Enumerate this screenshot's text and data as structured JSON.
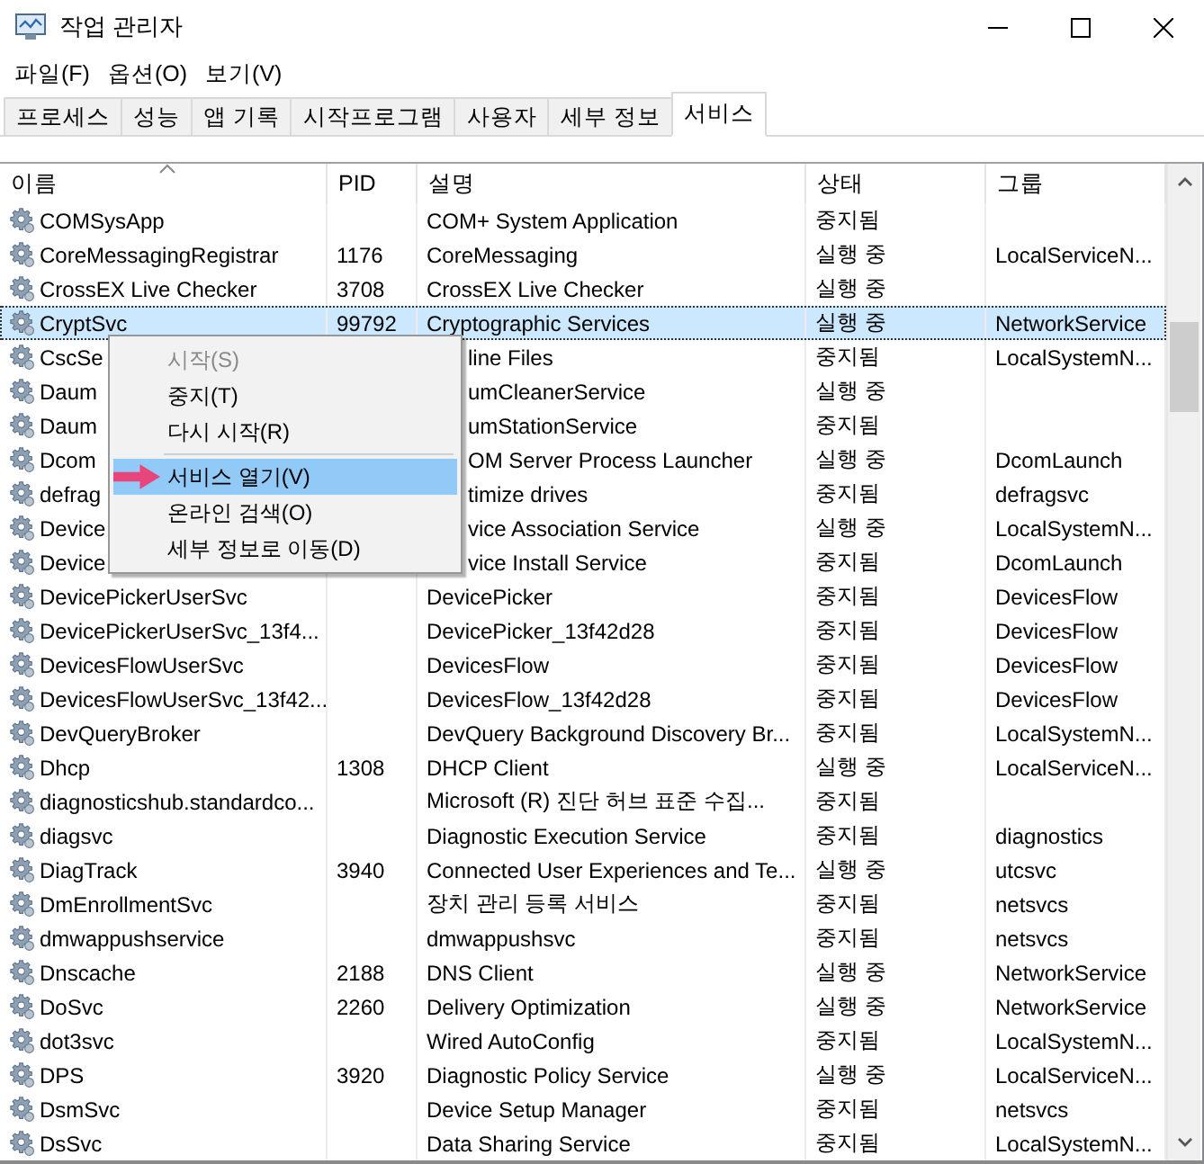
{
  "window": {
    "title": "작업 관리자"
  },
  "menu_bar": [
    "파일(F)",
    "옵션(O)",
    "보기(V)"
  ],
  "tabs": [
    {
      "label": "프로세스",
      "selected": false
    },
    {
      "label": "성능",
      "selected": false
    },
    {
      "label": "앱 기록",
      "selected": false
    },
    {
      "label": "시작프로그램",
      "selected": false
    },
    {
      "label": "사용자",
      "selected": false
    },
    {
      "label": "세부 정보",
      "selected": false
    },
    {
      "label": "서비스",
      "selected": true
    }
  ],
  "table": {
    "columns": [
      "이름",
      "PID",
      "설명",
      "상태",
      "그룹"
    ],
    "rows": [
      {
        "kind": "full",
        "selected": false,
        "name": "COMSysApp",
        "description": "COM+ System Application",
        "status": "중지됨"
      },
      {
        "kind": "full",
        "selected": false,
        "name": "CoreMessagingRegistrar",
        "pid": "1176",
        "description": "CoreMessaging",
        "status": "실행 중",
        "group": "LocalServiceN..."
      },
      {
        "kind": "full",
        "selected": false,
        "name": "CrossEX Live Checker",
        "pid": "3708",
        "description": "CrossEX Live Checker",
        "status": "실행 중"
      },
      {
        "kind": "full",
        "selected": true,
        "name": "CryptSvc",
        "pid": "99792",
        "description": "Cryptographic Services",
        "status": "실행 중",
        "group": "NetworkService"
      },
      {
        "kind": "partly_hidden",
        "selected": false,
        "name": "CscSe",
        "description": "line Files",
        "status": "중지됨",
        "group": "LocalSystemN..."
      },
      {
        "kind": "partly_hidden",
        "selected": false,
        "name": "Daum",
        "description": "umCleanerService",
        "status": "실행 중"
      },
      {
        "kind": "partly_hidden",
        "selected": false,
        "name": "Daum",
        "description": "umStationService",
        "status": "중지됨"
      },
      {
        "kind": "partly_hidden",
        "selected": false,
        "name": "Dcom",
        "description": "OM Server Process Launcher",
        "status": "실행 중",
        "group": "DcomLaunch"
      },
      {
        "kind": "partly_hidden",
        "selected": false,
        "name": "defrag",
        "description": "timize drives",
        "status": "중지됨",
        "group": "defragsvc"
      },
      {
        "kind": "partly_hidden",
        "selected": false,
        "name": "Device",
        "description": "vice Association Service",
        "status": "실행 중",
        "group": "LocalSystemN..."
      },
      {
        "kind": "partly_hidden",
        "selected": false,
        "name": "Device",
        "description": "vice Install Service",
        "status": "중지됨",
        "group": "DcomLaunch"
      },
      {
        "kind": "full",
        "selected": false,
        "name": "DevicePickerUserSvc",
        "description": "DevicePicker",
        "status": "중지됨",
        "group": "DevicesFlow"
      },
      {
        "kind": "full",
        "selected": false,
        "name": "DevicePickerUserSvc_13f4...",
        "description": "DevicePicker_13f42d28",
        "status": "중지됨",
        "group": "DevicesFlow"
      },
      {
        "kind": "full",
        "selected": false,
        "name": "DevicesFlowUserSvc",
        "description": "DevicesFlow",
        "status": "중지됨",
        "group": "DevicesFlow"
      },
      {
        "kind": "full",
        "selected": false,
        "name": "DevicesFlowUserSvc_13f42...",
        "description": "DevicesFlow_13f42d28",
        "status": "중지됨",
        "group": "DevicesFlow"
      },
      {
        "kind": "full",
        "selected": false,
        "name": "DevQueryBroker",
        "description": "DevQuery Background Discovery Br...",
        "status": "중지됨",
        "group": "LocalSystemN..."
      },
      {
        "kind": "full",
        "selected": false,
        "name": "Dhcp",
        "pid": "1308",
        "description": "DHCP Client",
        "status": "실행 중",
        "group": "LocalServiceN..."
      },
      {
        "kind": "full",
        "selected": false,
        "name": "diagnosticshub.standardco...",
        "description": "Microsoft (R) 진단 허브 표준 수집...",
        "status": "중지됨"
      },
      {
        "kind": "full",
        "selected": false,
        "name": "diagsvc",
        "description": "Diagnostic Execution Service",
        "status": "중지됨",
        "group": "diagnostics"
      },
      {
        "kind": "full",
        "selected": false,
        "name": "DiagTrack",
        "pid": "3940",
        "description": "Connected User Experiences and Te...",
        "status": "실행 중",
        "group": "utcsvc"
      },
      {
        "kind": "full",
        "selected": false,
        "name": "DmEnrollmentSvc",
        "description": "장치 관리 등록 서비스",
        "status": "중지됨",
        "group": "netsvcs"
      },
      {
        "kind": "full",
        "selected": false,
        "name": "dmwappushservice",
        "description": "dmwappushsvc",
        "status": "중지됨",
        "group": "netsvcs"
      },
      {
        "kind": "full",
        "selected": false,
        "name": "Dnscache",
        "pid": "2188",
        "description": "DNS Client",
        "status": "실행 중",
        "group": "NetworkService"
      },
      {
        "kind": "full",
        "selected": false,
        "name": "DoSvc",
        "pid": "2260",
        "description": "Delivery Optimization",
        "status": "실행 중",
        "group": "NetworkService"
      },
      {
        "kind": "full",
        "selected": false,
        "name": "dot3svc",
        "description": "Wired AutoConfig",
        "status": "중지됨",
        "group": "LocalSystemN..."
      },
      {
        "kind": "full",
        "selected": false,
        "name": "DPS",
        "pid": "3920",
        "description": "Diagnostic Policy Service",
        "status": "실행 중",
        "group": "LocalServiceN..."
      },
      {
        "kind": "full",
        "selected": false,
        "name": "DsmSvc",
        "description": "Device Setup Manager",
        "status": "중지됨",
        "group": "netsvcs"
      },
      {
        "kind": "full",
        "selected": false,
        "name": "DsSvc",
        "description": "Data Sharing Service",
        "status": "중지됨",
        "group": "LocalSystemN..."
      }
    ]
  },
  "context_menu": {
    "items": [
      {
        "kind": "item",
        "label": "시작(S)",
        "disabled": true,
        "selected": false
      },
      {
        "kind": "item",
        "label": "중지(T)",
        "disabled": false,
        "selected": false
      },
      {
        "kind": "item",
        "label": "다시 시작(R)",
        "disabled": false,
        "selected": false
      },
      {
        "kind": "separator"
      },
      {
        "kind": "item",
        "label": "서비스 열기(V)",
        "disabled": false,
        "selected": true
      },
      {
        "kind": "item",
        "label": "온라인 검색(O)",
        "disabled": false,
        "selected": false
      },
      {
        "kind": "item",
        "label": "세부 정보로 이동(D)",
        "disabled": false,
        "selected": false
      }
    ]
  }
}
